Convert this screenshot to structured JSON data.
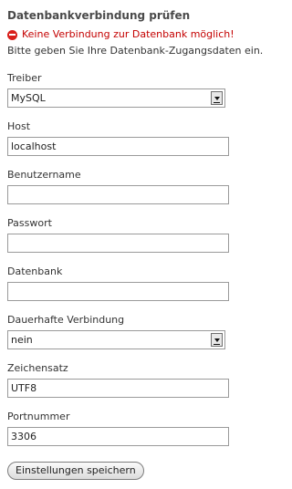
{
  "header": {
    "title": "Datenbankverbindung prüfen",
    "error_message": "Keine Verbindung zur Datenbank möglich!",
    "intro_text": "Bitte geben Sie Ihre Datenbank-Zugangsdaten ein."
  },
  "form": {
    "driver": {
      "label": "Treiber",
      "value": "MySQL"
    },
    "host": {
      "label": "Host",
      "value": "localhost"
    },
    "username": {
      "label": "Benutzername",
      "value": ""
    },
    "password": {
      "label": "Passwort",
      "value": ""
    },
    "database": {
      "label": "Datenbank",
      "value": ""
    },
    "persistent": {
      "label": "Dauerhafte Verbindung",
      "value": "nein"
    },
    "charset": {
      "label": "Zeichensatz",
      "value": "UTF8"
    },
    "port": {
      "label": "Portnummer",
      "value": "3306"
    },
    "submit_label": "Einstellungen speichern"
  },
  "colors": {
    "error": "#c40000",
    "error_icon": "#d9201b"
  },
  "icons": {
    "error": "stop-icon"
  }
}
